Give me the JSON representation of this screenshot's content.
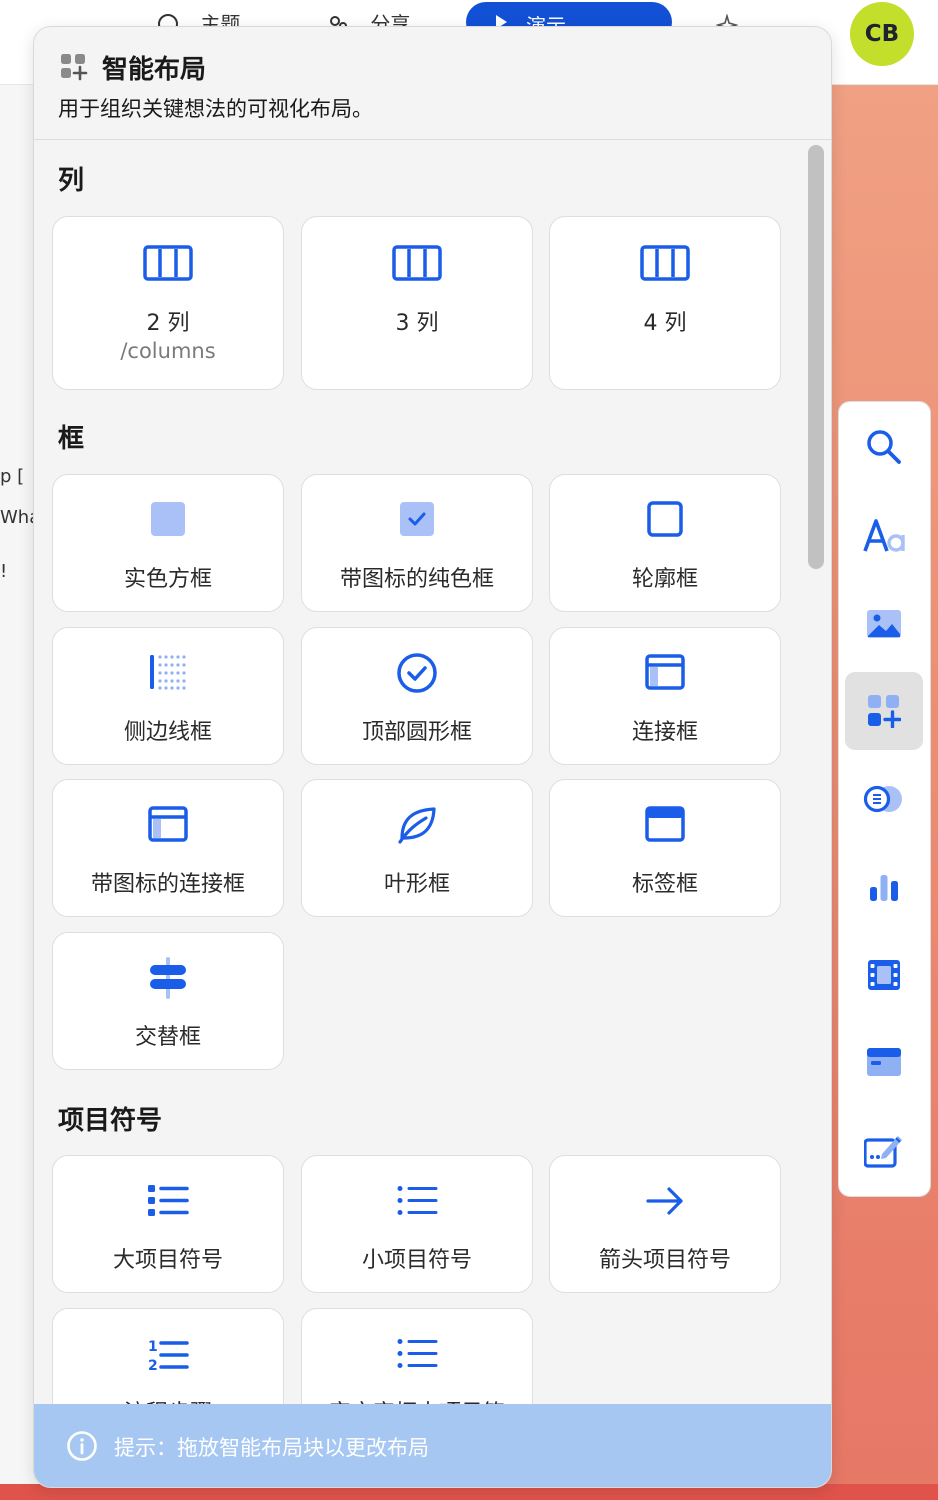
{
  "topbar": {
    "theme_label": "主题",
    "share_label": "分享",
    "present_label": "演示",
    "avatar_initials": "CB"
  },
  "background_peek": [
    "p [",
    "Wha",
    "!"
  ],
  "panel": {
    "title": "智能布局",
    "subtitle": "用于组织关键想法的可视化布局。",
    "sections": {
      "columns": {
        "title": "列",
        "items": [
          {
            "label": "2 列",
            "sub": "/columns",
            "icon": "columns-icon"
          },
          {
            "label": "3 列",
            "icon": "columns-icon"
          },
          {
            "label": "4 列",
            "icon": "columns-icon"
          }
        ]
      },
      "boxes": {
        "title": "框",
        "items": [
          {
            "label": "实色方框",
            "icon": "solid-box-icon"
          },
          {
            "label": "带图标的纯色框",
            "icon": "checked-box-icon"
          },
          {
            "label": "轮廓框",
            "icon": "outline-box-icon"
          },
          {
            "label": "侧边线框",
            "icon": "side-line-box-icon"
          },
          {
            "label": "顶部圆形框",
            "icon": "circle-check-icon"
          },
          {
            "label": "连接框",
            "icon": "joined-box-icon"
          },
          {
            "label": "带图标的连接框",
            "icon": "joined-box-with-icon-icon"
          },
          {
            "label": "叶形框",
            "icon": "leaf-icon"
          },
          {
            "label": "标签框",
            "icon": "label-box-icon"
          },
          {
            "label": "交替框",
            "icon": "signpost-icon"
          }
        ]
      },
      "bullets": {
        "title": "项目符号",
        "items": [
          {
            "label": "大项目符号",
            "icon": "large-bullets-icon"
          },
          {
            "label": "小项目符号",
            "icon": "small-bullets-icon"
          },
          {
            "label": "箭头项目符号",
            "icon": "arrow-right-icon"
          },
          {
            "label": "流程步骤",
            "icon": "numbered-list-icon"
          },
          {
            "label": "字文字框中项目符",
            "icon": "bullet-list-icon"
          }
        ]
      }
    },
    "hint": "提示：拖放智能布局块以更改布局"
  },
  "toolbar": {
    "tools": [
      "search-icon",
      "text-style-icon",
      "image-icon",
      "smart-layout-icon",
      "toggle-icon",
      "chart-icon",
      "video-icon",
      "embed-icon",
      "edit-icon"
    ],
    "active_tool": "smart-layout-icon"
  },
  "colors": {
    "accent": "#1a5de8",
    "panel_bg": "#f4f4f4",
    "hint_bg": "#a7c7f3",
    "avatar_bg": "#c3df2c"
  }
}
